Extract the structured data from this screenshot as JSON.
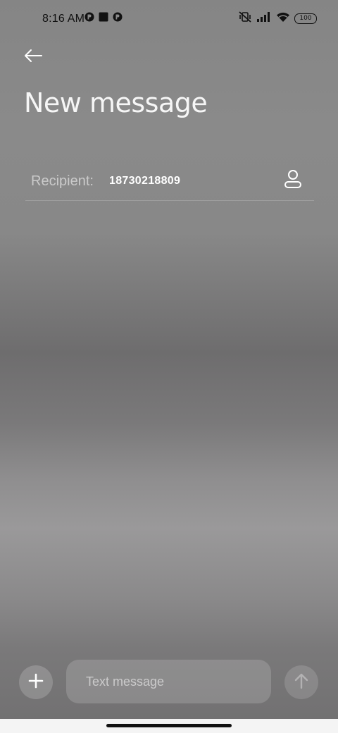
{
  "status_bar": {
    "time": "8:16 AM",
    "left_icons": [
      "notification-app-icon",
      "notification-square-icon",
      "notification-app-icon"
    ],
    "right_icons": [
      "vibrate-off-icon",
      "signal-icon",
      "wifi-icon"
    ],
    "battery": "100"
  },
  "header": {
    "back_icon": "arrow-left-icon",
    "title": "New message"
  },
  "recipient": {
    "label": "Recipient:",
    "value": "18730218809",
    "contact_icon": "person-icon"
  },
  "composer": {
    "add_icon": "plus-icon",
    "placeholder": "Text message",
    "send_icon": "arrow-up-icon"
  },
  "colors": {
    "text_primary": "#ffffff",
    "status_text": "#111111",
    "nav_bar": "#f4f4f4"
  }
}
